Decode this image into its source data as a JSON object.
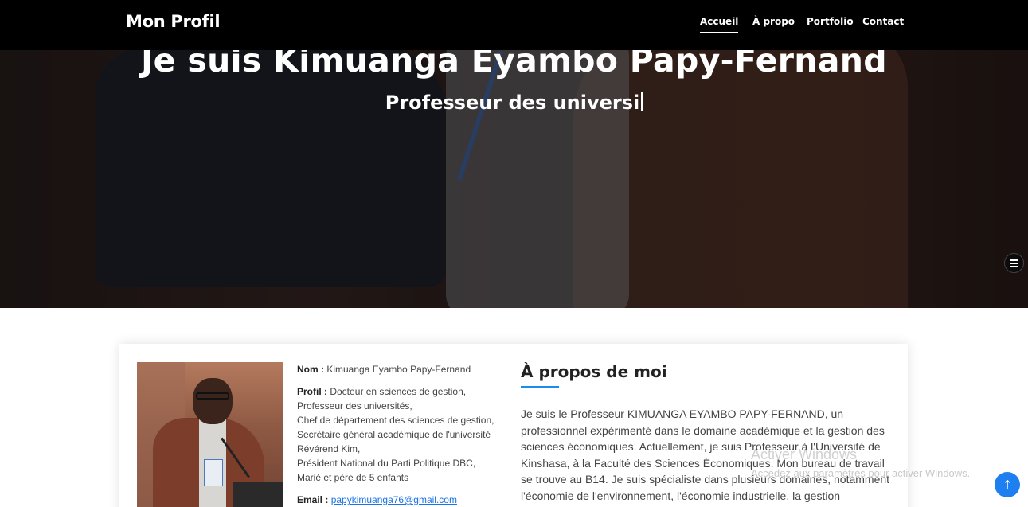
{
  "navbar": {
    "brand": "Mon Profil",
    "links": [
      {
        "label": "Accueil",
        "active": true
      },
      {
        "label": "À propo",
        "active": false
      },
      {
        "label": "Portfolio",
        "active": false
      },
      {
        "label": "Contact",
        "active": false
      }
    ]
  },
  "hero": {
    "title": "Je suis Kimuanga Eyambo Papy-Fernand",
    "subtitle": "Professeur des universi"
  },
  "profile": {
    "name_label": "Nom :",
    "name_value": "Kimuanga Eyambo Papy-Fernand",
    "profil_label": "Profil :",
    "profil_lines": [
      "Docteur en sciences de gestion,",
      "Professeur des universités,",
      "Chef de département des sciences de gestion,",
      "Secrétaire général académique de l'université",
      "Révérend Kim,",
      "Président National du Parti Politique DBC,",
      "Marié et père de 5 enfants"
    ],
    "email_label": "Email :",
    "email_value": "papykimuanga76@gmail.com"
  },
  "about": {
    "title": "À propos de moi",
    "text": "Je suis le Professeur KIMUANGA EYAMBO PAPY-FERNAND, un professionnel expérimenté dans le domaine académique et la gestion des sciences économiques. Actuellement, je suis Professeur à l'Université de Kinshasa, à la Faculté des Sciences Économiques. Mon bureau de travail se trouve au B14. Je suis spécialiste dans plusieurs domaines, notamment l'économie de l'environnement, l'économie industrielle, la gestion économique des déchets,"
  },
  "watermark": {
    "line1": "Activer Windows",
    "line2": "Accédez aux paramètres pour activer Windows."
  },
  "colors": {
    "accent": "#1a8bf0",
    "navbar_bg": "#000000",
    "link": "#1a73e8"
  },
  "icons": {
    "side_toggle": "menu-lines-icon",
    "back_to_top": "arrow-up-icon"
  }
}
